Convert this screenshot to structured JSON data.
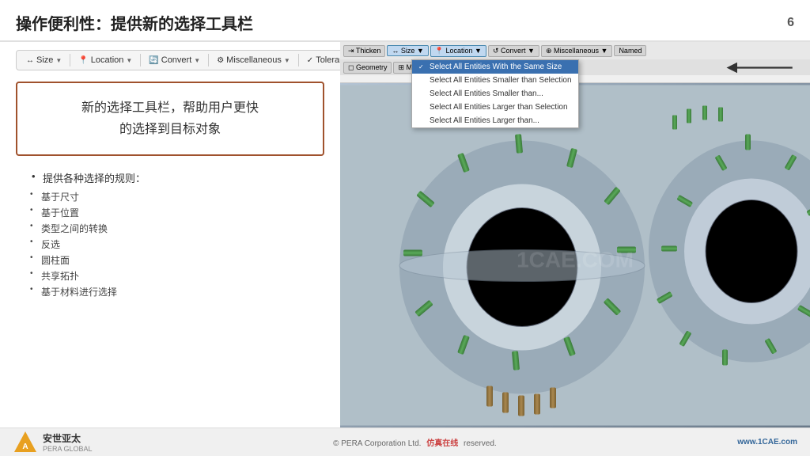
{
  "header": {
    "title": "操作便利性：提供新的选择工具栏",
    "slide_number": "6"
  },
  "toolbar": {
    "items": [
      {
        "label": "↔ Size",
        "icon": "↔",
        "has_dropdown": true
      },
      {
        "label": "Location",
        "icon": "📍",
        "has_dropdown": true
      },
      {
        "label": "Convert",
        "icon": "🔄",
        "has_dropdown": true
      },
      {
        "label": "Miscellaneous",
        "icon": "⚙",
        "has_dropdown": true
      },
      {
        "label": "Tolerances",
        "icon": "✓",
        "has_dropdown": false
      }
    ]
  },
  "highlight_box": {
    "line1": "新的选择工具栏，帮助用户更快",
    "line2": "的选择到目标对象"
  },
  "bullets": {
    "main": "提供各种选择的规则：",
    "items": [
      "基于尺寸",
      "基于位置",
      "类型之间的转换",
      "反选",
      "圆柱面",
      "共享拓扑",
      "基于材料进行选择"
    ]
  },
  "software_ui": {
    "toolbar_buttons": [
      "Thicken",
      "Size ▼",
      "Location ▼",
      "Convert ▼",
      "Miscellaneous ▼",
      "Named"
    ],
    "toolbar2_buttons": [
      "Geometry",
      "Mesh Edit"
    ],
    "dropdown_items": [
      "Select All Entities With the Same Size",
      "Select All Entities Smaller than Selection",
      "Select All Entities Smaller than...",
      "Select All Entities Larger than Selection",
      "Select All Entities Larger than..."
    ]
  },
  "watermark": "1CAE.COM",
  "footer": {
    "logo_name": "安世亚太",
    "logo_subtitle": "PERA GLOBAL",
    "copyright": "© PERA Corporation Ltd.",
    "tagline": "仿真在线",
    "website": "www.1CAE.com",
    "rights": "reserved."
  }
}
